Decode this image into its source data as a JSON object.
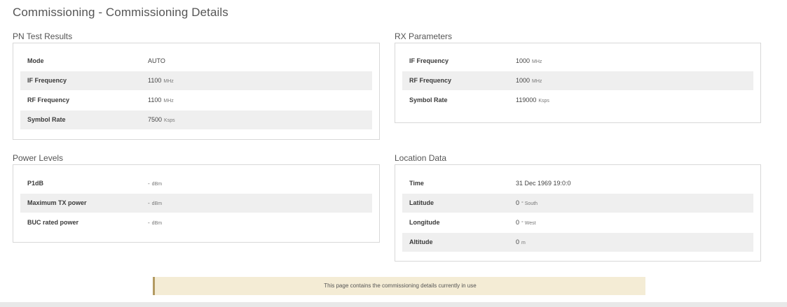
{
  "page_title": "Commissioning - Commissioning Details",
  "pn_test": {
    "title": "PN Test Results",
    "rows": [
      {
        "label": "Mode",
        "value": "AUTO",
        "unit": ""
      },
      {
        "label": "IF Frequency",
        "value": "1100",
        "unit": "MHz"
      },
      {
        "label": "RF Frequency",
        "value": "1100",
        "unit": "MHz"
      },
      {
        "label": "Symbol Rate",
        "value": "7500",
        "unit": "Ksps"
      }
    ]
  },
  "rx_params": {
    "title": "RX Parameters",
    "rows": [
      {
        "label": "IF Frequency",
        "value": "1000",
        "unit": "MHz"
      },
      {
        "label": "RF Frequency",
        "value": "1000",
        "unit": "MHz"
      },
      {
        "label": "Symbol Rate",
        "value": "119000",
        "unit": "Ksps"
      }
    ]
  },
  "power_levels": {
    "title": "Power Levels",
    "rows": [
      {
        "label": "P1dB",
        "value": "-",
        "unit": "dBm"
      },
      {
        "label": "Maximum TX power",
        "value": "-",
        "unit": "dBm"
      },
      {
        "label": "BUC rated power",
        "value": "-",
        "unit": "dBm"
      }
    ]
  },
  "location": {
    "title": "Location Data",
    "rows": [
      {
        "label": "Time",
        "value": "31 Dec 1969 19:0:0",
        "unit": ""
      },
      {
        "label": "Latitude",
        "value": "0",
        "unit": "° South"
      },
      {
        "label": "Longitude",
        "value": "0",
        "unit": "° West"
      },
      {
        "label": "Altitude",
        "value": "0",
        "unit": "m"
      }
    ]
  },
  "notice": "This page contains the commissioning details currently in use"
}
